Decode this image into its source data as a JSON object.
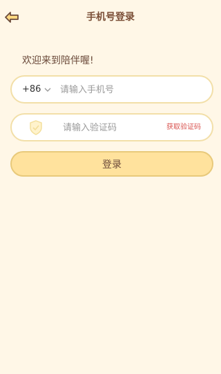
{
  "header": {
    "title": "手机号登录",
    "back_icon": "arrow-left-icon"
  },
  "welcome_text": "欢迎来到陪伴喔!",
  "phone_field": {
    "country_code": "+86",
    "placeholder": "请输入手机号",
    "value": ""
  },
  "code_field": {
    "placeholder": "请输入验证码",
    "value": "",
    "get_code_label": "获取验证码",
    "icon": "shield-check-icon"
  },
  "login_button": {
    "label": "登录"
  },
  "colors": {
    "background": "#FFF7E7",
    "title": "#7A4E36",
    "field_border": "#F2DFA8",
    "button_fill": "#FFE29D",
    "button_border": "#E8C97A",
    "get_code": "#D9534F"
  }
}
